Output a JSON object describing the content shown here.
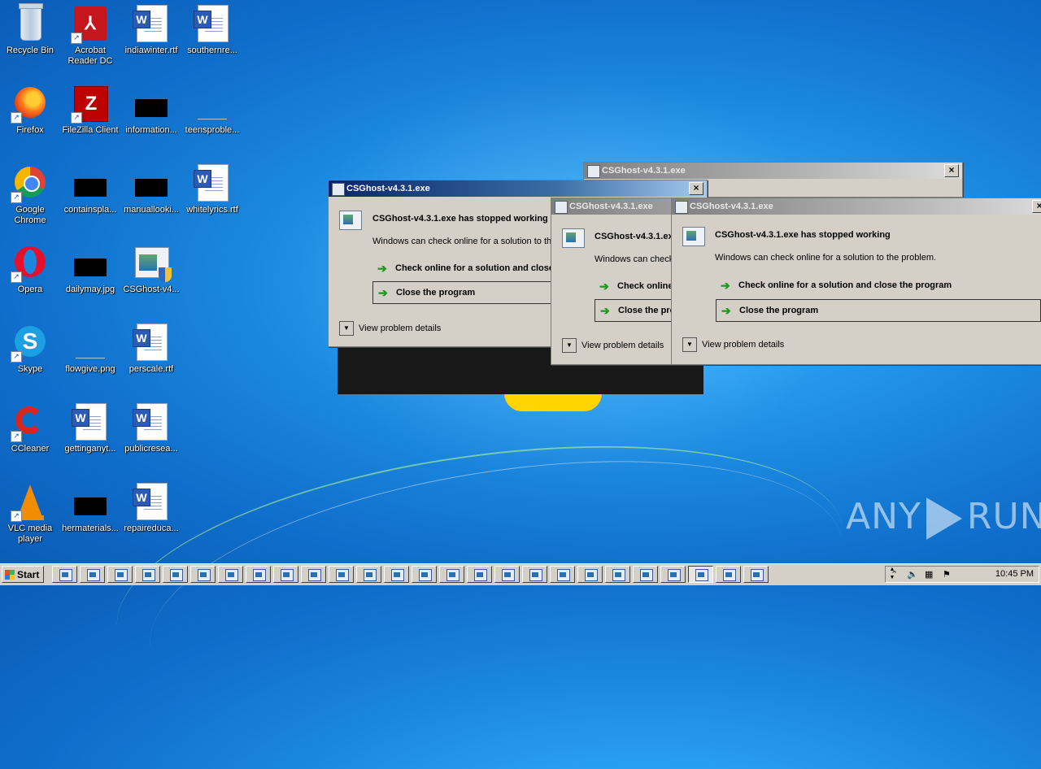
{
  "desktop": {
    "icons": [
      {
        "label": "Recycle Bin",
        "icon": "recycle-bin-icon"
      },
      {
        "label": "Acrobat Reader DC",
        "icon": "acrobat-reader-icon"
      },
      {
        "label": "indiawinter.rtf",
        "icon": "word-document-icon"
      },
      {
        "label": "southernre...",
        "icon": "word-document-icon"
      },
      {
        "label": "Firefox",
        "icon": "firefox-icon"
      },
      {
        "label": "FileZilla Client",
        "icon": "filezilla-icon"
      },
      {
        "label": "information...",
        "icon": "black-image-thumbnail-icon"
      },
      {
        "label": "teensproble...",
        "icon": "blank-image-thumbnail-icon"
      },
      {
        "label": "Google Chrome",
        "icon": "chrome-icon"
      },
      {
        "label": "containspla...",
        "icon": "black-image-thumbnail-icon"
      },
      {
        "label": "manuallooki...",
        "icon": "black-image-thumbnail-icon"
      },
      {
        "label": "whitelyrics.rtf",
        "icon": "word-document-icon"
      },
      {
        "label": "Opera",
        "icon": "opera-icon"
      },
      {
        "label": "dailymay.jpg",
        "icon": "black-image-thumbnail-icon"
      },
      {
        "label": "CSGhost-v4...",
        "icon": "csghost-executable-icon"
      },
      {
        "label": "Skype",
        "icon": "skype-icon"
      },
      {
        "label": "flowgive.png",
        "icon": "blank-image-thumbnail-icon"
      },
      {
        "label": "perscale.rtf",
        "icon": "word-document-icon"
      },
      {
        "label": "CCleaner",
        "icon": "ccleaner-icon"
      },
      {
        "label": "gettinganyt...",
        "icon": "word-document-icon"
      },
      {
        "label": "publicresea...",
        "icon": "word-document-icon"
      },
      {
        "label": "VLC media player",
        "icon": "vlc-icon"
      },
      {
        "label": "hermaterials...",
        "icon": "black-image-thumbnail-icon"
      },
      {
        "label": "repaireduca...",
        "icon": "word-document-icon"
      }
    ]
  },
  "dialogs": {
    "back": {
      "title": "CSGhost-v4.3.1.exe"
    },
    "main": {
      "title": "CSGhost-v4.3.1.exe",
      "heading": "CSGhost-v4.3.1.exe has stopped working",
      "message": "Windows can check online for a solution to the problem.",
      "option_check": "Check online for a solution and close the program",
      "option_close": "Close the program",
      "details": "View problem details"
    },
    "middle": {
      "title": "CSGhost-v4.3.1.exe",
      "heading": "CSGhost-v4.3.1.exe has stopped working",
      "message": "Windows can check online for a solution to the problem.",
      "option_check": "Check online for a solution and close the program",
      "option_close": "Close the program",
      "details": "View problem details"
    },
    "front": {
      "title": "CSGhost-v4.3.1.exe",
      "heading": "CSGhost-v4.3.1.exe has stopped working",
      "message": "Windows can check online for a solution to the problem.",
      "option_check": "Check online for a solution and close the program",
      "option_close": "Close the program",
      "details": "View problem details"
    }
  },
  "watermark": {
    "left": "ANY",
    "right": "RUN"
  },
  "taskbar": {
    "start_label": "Start",
    "clock": "10:45 PM",
    "button_count_note": "",
    "tray_icons": [
      "show-hidden-icons-icon",
      "volume-icon",
      "network-icon",
      "action-center-flag-icon"
    ]
  }
}
